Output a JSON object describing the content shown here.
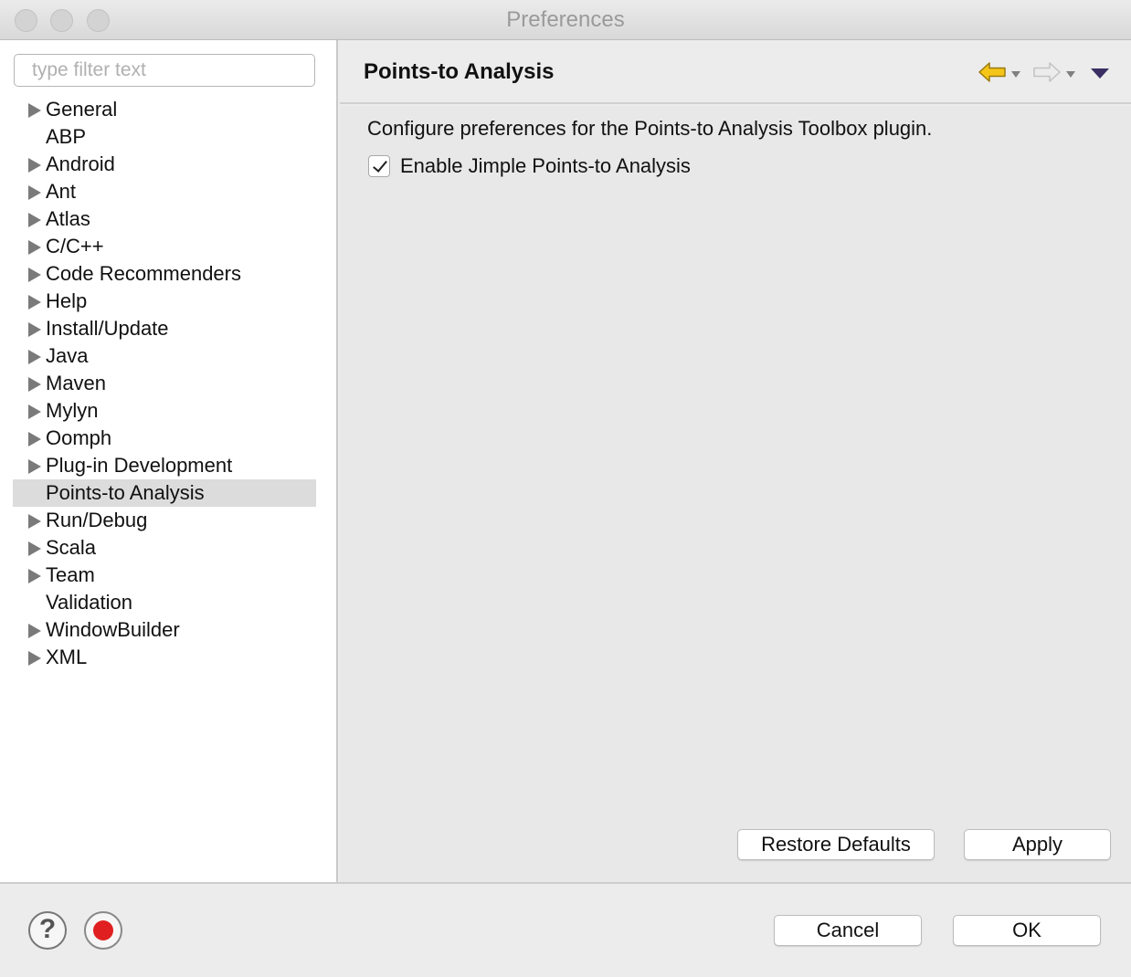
{
  "window": {
    "title": "Preferences"
  },
  "filter": {
    "placeholder": "type filter text",
    "value": ""
  },
  "tree": {
    "items": [
      {
        "label": "General",
        "expandable": true,
        "selected": false
      },
      {
        "label": "ABP",
        "expandable": false,
        "selected": false
      },
      {
        "label": "Android",
        "expandable": true,
        "selected": false
      },
      {
        "label": "Ant",
        "expandable": true,
        "selected": false
      },
      {
        "label": "Atlas",
        "expandable": true,
        "selected": false
      },
      {
        "label": "C/C++",
        "expandable": true,
        "selected": false
      },
      {
        "label": "Code Recommenders",
        "expandable": true,
        "selected": false
      },
      {
        "label": "Help",
        "expandable": true,
        "selected": false
      },
      {
        "label": "Install/Update",
        "expandable": true,
        "selected": false
      },
      {
        "label": "Java",
        "expandable": true,
        "selected": false
      },
      {
        "label": "Maven",
        "expandable": true,
        "selected": false
      },
      {
        "label": "Mylyn",
        "expandable": true,
        "selected": false
      },
      {
        "label": "Oomph",
        "expandable": true,
        "selected": false
      },
      {
        "label": "Plug-in Development",
        "expandable": true,
        "selected": false
      },
      {
        "label": "Points-to Analysis",
        "expandable": false,
        "selected": true
      },
      {
        "label": "Run/Debug",
        "expandable": true,
        "selected": false
      },
      {
        "label": "Scala",
        "expandable": true,
        "selected": false
      },
      {
        "label": "Team",
        "expandable": true,
        "selected": false
      },
      {
        "label": "Validation",
        "expandable": false,
        "selected": false
      },
      {
        "label": "WindowBuilder",
        "expandable": true,
        "selected": false
      },
      {
        "label": "XML",
        "expandable": true,
        "selected": false
      }
    ]
  },
  "page": {
    "title": "Points-to Analysis",
    "description": "Configure preferences for the Points-to Analysis Toolbox plugin.",
    "checkbox": {
      "label": "Enable Jimple Points-to Analysis",
      "checked": true
    },
    "restore_label": "Restore Defaults",
    "apply_label": "Apply"
  },
  "nav": {
    "back_icon": "arrow-left-icon",
    "forward_icon": "arrow-right-icon",
    "menu_icon": "view-menu-icon"
  },
  "footer": {
    "help_icon": "help-icon",
    "record_icon": "record-icon",
    "cancel_label": "Cancel",
    "ok_label": "OK"
  },
  "colors": {
    "selection": "#dcdcdc",
    "back_arrow": "#f5c518",
    "record": "#e02020",
    "menu_triangle": "#3a2e63"
  }
}
